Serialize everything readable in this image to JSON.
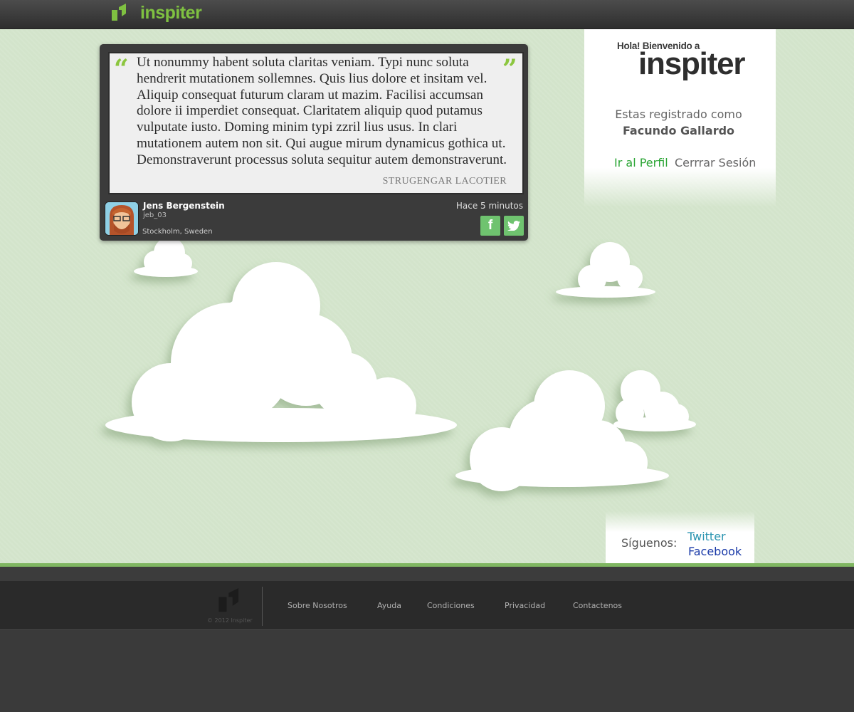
{
  "header": {
    "brand": "inspiter"
  },
  "quote": {
    "text": "Ut nonummy habent soluta claritas veniam. Typi nunc soluta hendrerit mutationem sollemnes. Quis lius dolore et insitam vel. Aliquip consequat futurum claram ut mazim. Facilisi accumsan dolore ii imperdiet consequat. Claritatem aliquip quod putamus vulputate iusto. Doming minim typi zzril lius usus. In clari mutationem autem non sit. Qui augue mirum dynamicus gothica ut. Demonstraverunt processus soluta sequitur autem demonstraverunt.",
    "author": "STRUGENGAR LACOTIER",
    "user": {
      "name": "Jens Bergenstein",
      "handle": "jeb_03",
      "location": "Stockholm, Sweden"
    },
    "time": "Hace 5 minutos",
    "share_facebook": "f",
    "share_twitter_icon": "bird-icon"
  },
  "welcome": {
    "greeting": "Hola! Bienvenido a",
    "brand": "inspiter",
    "registered_label": "Estas registrado como",
    "registered_user": "Facundo Gallardo",
    "profile_link": "Ir al Perfil",
    "logout_link": "Cerrrar Sesión"
  },
  "follow": {
    "label": "Síguenos:",
    "twitter": "Twitter",
    "facebook": "Facebook"
  },
  "footer": {
    "copyright": "© 2012 Inspiter",
    "links": [
      "Sobre Nosotros",
      "Ayuda",
      "Condiciones",
      "Privacidad",
      "Contactenos"
    ]
  },
  "colors": {
    "brand_green": "#7fc141",
    "background_green": "#d3e4cb",
    "dark": "#3b3b3b"
  }
}
